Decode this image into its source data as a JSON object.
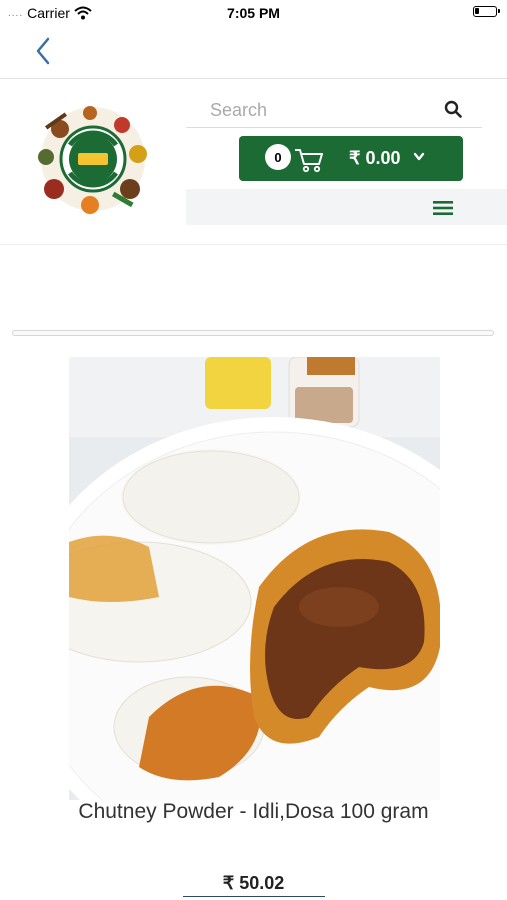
{
  "status_bar": {
    "signal": "....",
    "carrier": "Carrier",
    "time": "7:05 PM"
  },
  "header": {
    "logo_name": "Miller logo",
    "search": {
      "placeholder": "Search",
      "value": ""
    },
    "cart": {
      "count": "0",
      "total": "₹ 0.00"
    }
  },
  "product": {
    "title": "Chutney Powder - Idli,Dosa 100 gram",
    "price": "₹ 50.02"
  },
  "colors": {
    "brand_green": "#1c6b34",
    "menu_bar": "#f3f4f6"
  },
  "icons": [
    "wifi-icon",
    "battery-icon",
    "back-chevron-icon",
    "search-icon",
    "cart-icon",
    "chevron-down-icon",
    "hamburger-menu-icon"
  ]
}
